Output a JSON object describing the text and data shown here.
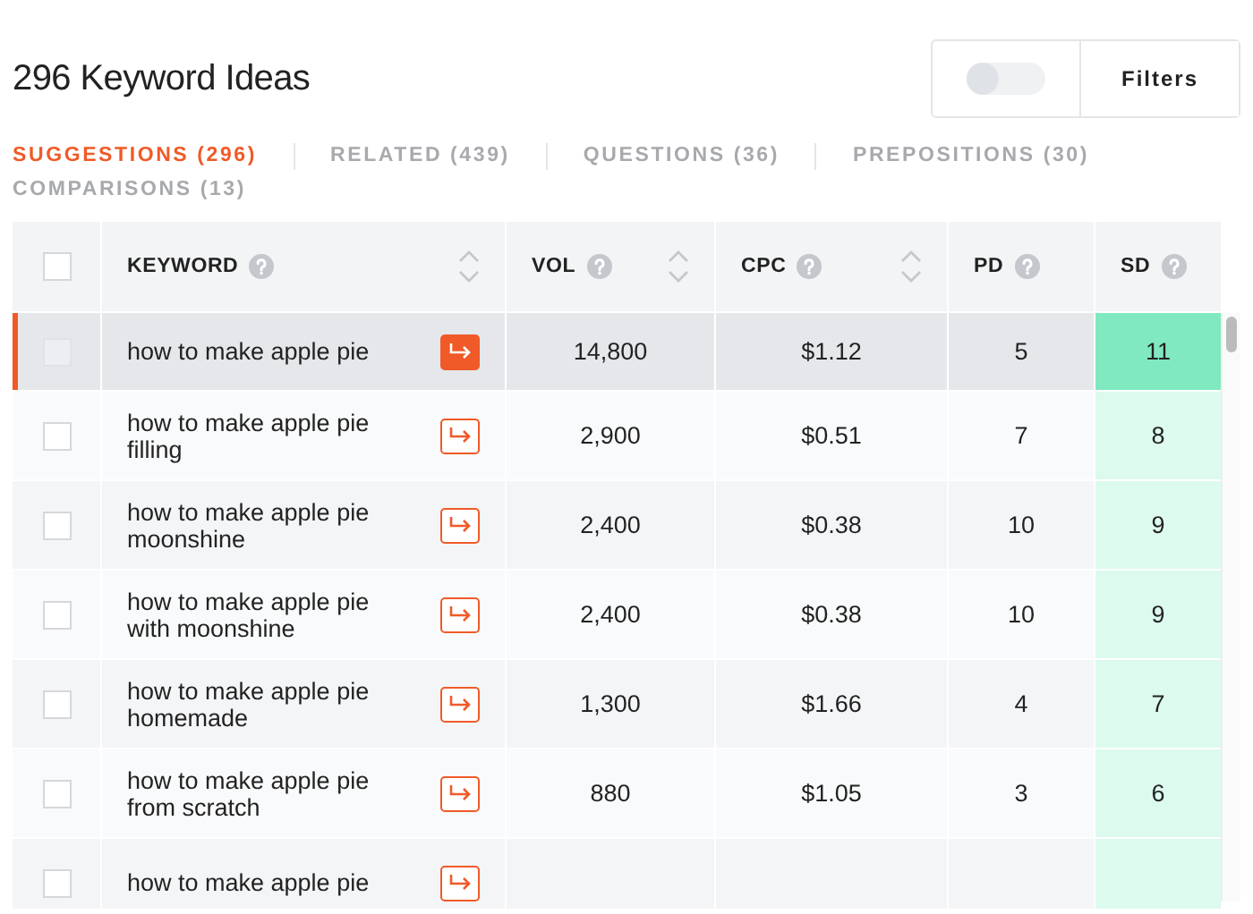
{
  "title": "296 Keyword Ideas",
  "toggle": {
    "on": false
  },
  "filters_button": "Filters",
  "tabs": [
    {
      "label": "SUGGESTIONS (296)",
      "selected": true
    },
    {
      "label": "RELATED (439)",
      "selected": false
    },
    {
      "label": "QUESTIONS (36)",
      "selected": false
    },
    {
      "label": "PREPOSITIONS (30)",
      "selected": false
    },
    {
      "label": "COMPARISONS (13)",
      "selected": false
    }
  ],
  "table": {
    "columns": [
      {
        "label": "KEYWORD",
        "sortable": true
      },
      {
        "label": "VOL",
        "sortable": true
      },
      {
        "label": "CPC",
        "sortable": true
      },
      {
        "label": "PD",
        "sortable": false
      },
      {
        "label": "SD",
        "sortable": false
      }
    ],
    "select_all_checked": false,
    "rows": [
      {
        "keyword": "how to make apple pie",
        "vol": "14,800",
        "cpc": "$1.12",
        "pd": "5",
        "sd": "11",
        "selected": true,
        "checked": false,
        "color": "#80e9c0"
      },
      {
        "keyword": "how to make apple pie filling",
        "vol": "2,900",
        "cpc": "$0.51",
        "pd": "7",
        "sd": "8",
        "selected": false,
        "checked": false,
        "color": "#dcfaee"
      },
      {
        "keyword": "how to make apple pie moonshine",
        "vol": "2,400",
        "cpc": "$0.38",
        "pd": "10",
        "sd": "9",
        "selected": false,
        "checked": false,
        "color": "#dcfaee"
      },
      {
        "keyword": "how to make apple pie with moonshine",
        "vol": "2,400",
        "cpc": "$0.38",
        "pd": "10",
        "sd": "9",
        "selected": false,
        "checked": false,
        "color": "#dcfaee"
      },
      {
        "keyword": "how to make apple pie homemade",
        "vol": "1,300",
        "cpc": "$1.66",
        "pd": "4",
        "sd": "7",
        "selected": false,
        "checked": false,
        "color": "#dcfaee"
      },
      {
        "keyword": "how to make apple pie from scratch",
        "vol": "880",
        "cpc": "$1.05",
        "pd": "3",
        "sd": "6",
        "selected": false,
        "checked": false,
        "color": "#dcfaee"
      },
      {
        "keyword": "how to make apple pie",
        "selected": false,
        "checked": false,
        "color": "#dcfaee"
      }
    ]
  }
}
